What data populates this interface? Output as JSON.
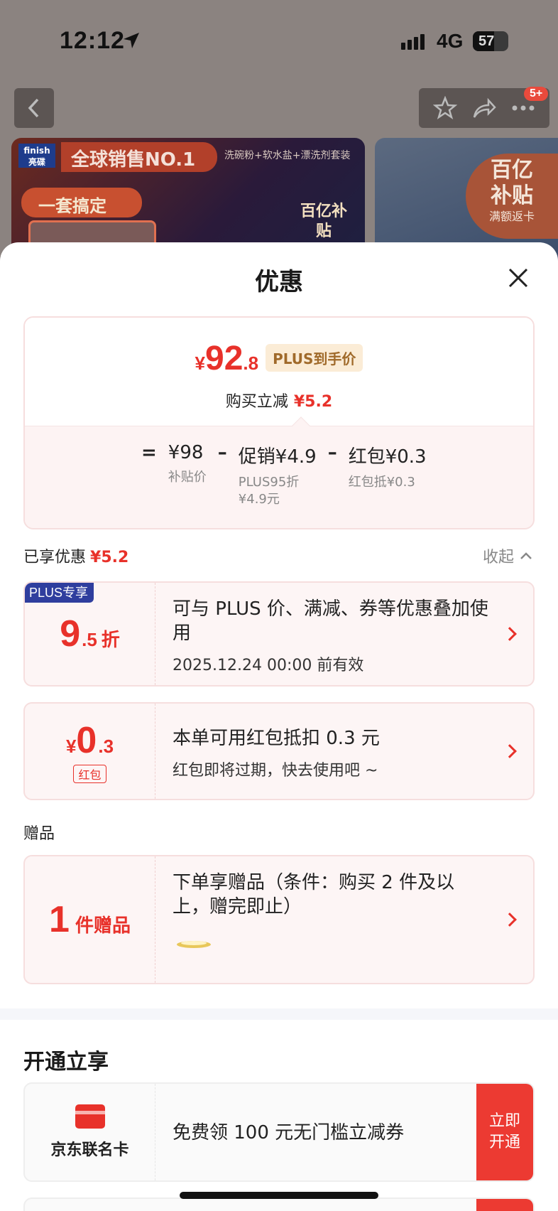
{
  "status": {
    "time": "12:12",
    "network": "4G",
    "battery": "57"
  },
  "nav": {
    "badge": "5+"
  },
  "banner": {
    "logo": "finish 亮碟",
    "title": "全球销售NO.1",
    "subtitle": "洗碗粉+软水盐+漂洗剂套装",
    "pill": "一套搞定",
    "badge": "百亿补贴"
  },
  "banner2": {
    "badge_line1": "百亿",
    "badge_line2": "补贴",
    "badge_sub": "满额返卡"
  },
  "sheet": {
    "title": "优惠",
    "summary": {
      "currency": "¥",
      "price_int": "92",
      "price_dec": ".8",
      "plus_tag": "PLUS到手价",
      "reduce_label": "购买立减",
      "reduce_value": "¥5.2",
      "eq": "=",
      "minus": "–",
      "terms": [
        {
          "value": "¥98",
          "sub": "补贴价"
        },
        {
          "value": "促销¥4.9",
          "sub": "PLUS95折",
          "sub2": "¥4.9元"
        },
        {
          "value": "红包¥0.3",
          "sub": "红包抵¥0.3"
        }
      ]
    },
    "enjoyed_label": "已享优惠",
    "enjoyed_value": "¥5.2",
    "collapse_label": "收起",
    "discount_card": {
      "corner": "PLUS专享",
      "big": "9",
      "small": ".5",
      "unit": "折",
      "title": "可与 PLUS 价、满减、券等优惠叠加使用",
      "sub": "2025.12.24 00:00 前有效"
    },
    "redpacket_card": {
      "currency": "¥",
      "big": "0",
      "small": ".3",
      "tag": "红包",
      "title": "本单可用红包抵扣 0.3 元",
      "sub": "红包即将过期，快去使用吧 ~"
    },
    "gift_label": "赠品",
    "gift_card": {
      "big": "1",
      "unit": "件赠品",
      "title": "下单享赠品（条件：购买 2 件及以上，赠完即止）"
    },
    "open_title": "开通立享",
    "open_card": {
      "icon_label": "京东联名卡",
      "title": "免费领 100 元无门槛立减券",
      "button": "立即开通"
    }
  }
}
